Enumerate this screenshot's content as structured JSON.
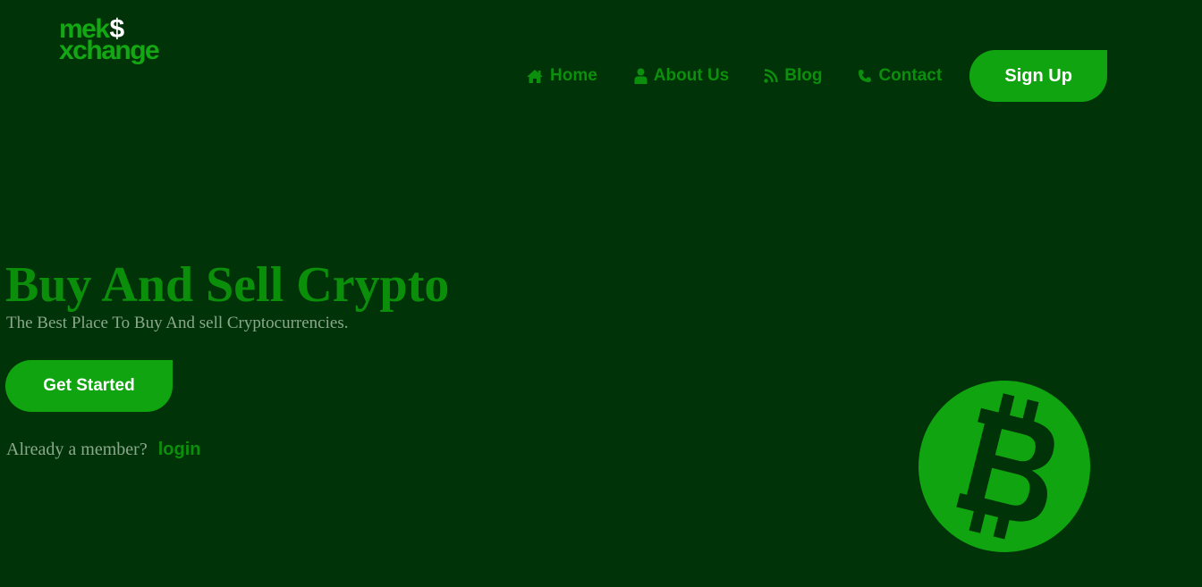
{
  "logo": {
    "line1": "mek",
    "dollar": "$",
    "line2": "xchange"
  },
  "nav": {
    "items": [
      {
        "label": "Home",
        "icon": "home-icon"
      },
      {
        "label": "About Us",
        "icon": "user-icon"
      },
      {
        "label": "Blog",
        "icon": "rss-icon"
      },
      {
        "label": "Contact",
        "icon": "phone-icon"
      }
    ],
    "signup_label": "Sign Up"
  },
  "hero": {
    "title": "Buy And Sell Crypto",
    "subtitle": "The Best Place To Buy And sell Cryptocurrencies.",
    "cta_label": "Get Started",
    "member_text": "Already a member?",
    "login_label": "login"
  },
  "illustration": {
    "icon": "bitcoin-icon"
  },
  "colors": {
    "background": "#003307",
    "accent": "#10a510",
    "link": "#0c8f0c",
    "muted_text": "#8aa88a"
  }
}
